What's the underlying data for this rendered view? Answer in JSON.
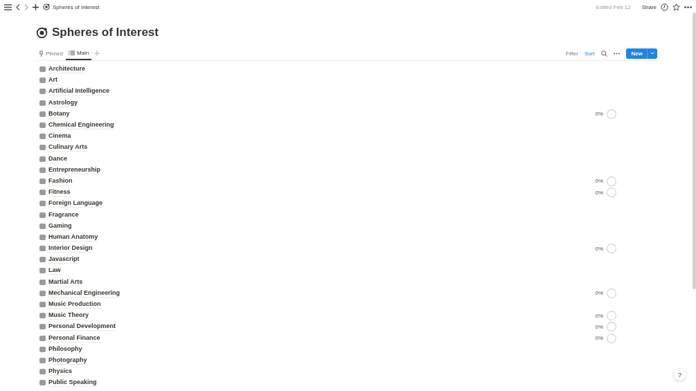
{
  "topbar": {
    "breadcrumb": "Spheres of Interest",
    "edited": "Edited Feb 12",
    "share": "Share"
  },
  "page": {
    "title": "Spheres of Interest"
  },
  "views": [
    {
      "label": "Pinned",
      "selected": false
    },
    {
      "label": "Main",
      "selected": true
    }
  ],
  "toolbar": {
    "filter": "Filter",
    "sort": "Sort",
    "new": "New"
  },
  "items": [
    {
      "name": "Architecture"
    },
    {
      "name": "Art"
    },
    {
      "name": "Artificial Intelligence"
    },
    {
      "name": "Astrology"
    },
    {
      "name": "Botany",
      "progress": {
        "reading": "0%"
      }
    },
    {
      "name": "Chemical Engineering"
    },
    {
      "name": "Cinema"
    },
    {
      "name": "Culinary Arts"
    },
    {
      "name": "Dance"
    },
    {
      "name": "Entrepreneurship"
    },
    {
      "name": "Fashion",
      "progress": {
        "reading": "0%"
      }
    },
    {
      "name": "Fitness",
      "progress": {
        "reading": "0%"
      }
    },
    {
      "name": "Foreign Language"
    },
    {
      "name": "Fragrance"
    },
    {
      "name": "Gaming"
    },
    {
      "name": "Human Anatomy"
    },
    {
      "name": "Interior Design",
      "progress": {
        "reading": "0%"
      }
    },
    {
      "name": "Javascript"
    },
    {
      "name": "Law"
    },
    {
      "name": "Martial Arts"
    },
    {
      "name": "Mechanical Engineering",
      "progress": {
        "reading": "0%"
      }
    },
    {
      "name": "Music Production"
    },
    {
      "name": "Music Theory",
      "progress": {
        "reading": "0%"
      }
    },
    {
      "name": "Personal Development",
      "progress": {
        "reading": "0%"
      }
    },
    {
      "name": "Personal Finance",
      "progress": {
        "reading": "0%"
      }
    },
    {
      "name": "Philosophy"
    },
    {
      "name": "Photography"
    },
    {
      "name": "Physics"
    },
    {
      "name": "Public Speaking"
    }
  ],
  "help": "?"
}
